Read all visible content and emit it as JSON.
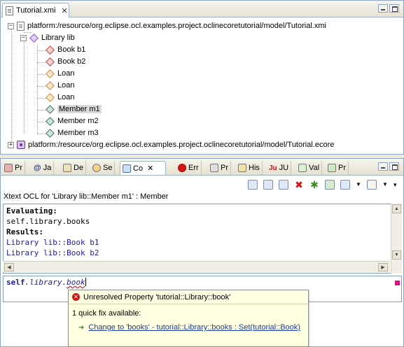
{
  "editor": {
    "tab_label": "Tutorial.xmi",
    "close_glyph": "✕",
    "tree": {
      "xmi_resource": "platform:/resource/org.eclipse.ocl.examples.project.oclinecoretutorial/model/Tutorial.xmi",
      "library": "Library lib",
      "items": [
        "Book b1",
        "Book b2",
        "Loan",
        "Loan",
        "Loan",
        "Member m1",
        "Member m2",
        "Member m3"
      ],
      "ecore_resource": "platform:/resource/org.eclipse.ocl.examples.project.oclinecoretutorial/model/Tutorial.ecore",
      "expand_minus": "−",
      "expand_plus": "+"
    }
  },
  "console": {
    "tabs": [
      "Pr",
      "Ja",
      "De",
      "Se",
      "Co",
      "Err",
      "Pr",
      "His",
      "JU",
      "Val",
      "Pr"
    ],
    "tab_prefix_ju": "Ju",
    "active_close": "✕",
    "title": "Xtext OCL for 'Library lib::Member m1' : Member",
    "output": {
      "line1": "Evaluating:",
      "line2": "self.library.books",
      "line3": "Results:",
      "line4": "Library lib::Book b1",
      "line5": "Library lib::Book b2"
    },
    "input": {
      "kw": "self",
      "dot1": ".",
      "part2": "library",
      "dot2": ".",
      "part3": "book"
    }
  },
  "quickfix": {
    "error": "Unresolved Property 'tutorial::Library::book'",
    "count": "1 quick fix available:",
    "fix": "Change to 'books' - tutorial::Library::books : Set(tutorial::Book)"
  },
  "colors": {
    "accent": "#1a1aa8",
    "error": "#d01818"
  }
}
